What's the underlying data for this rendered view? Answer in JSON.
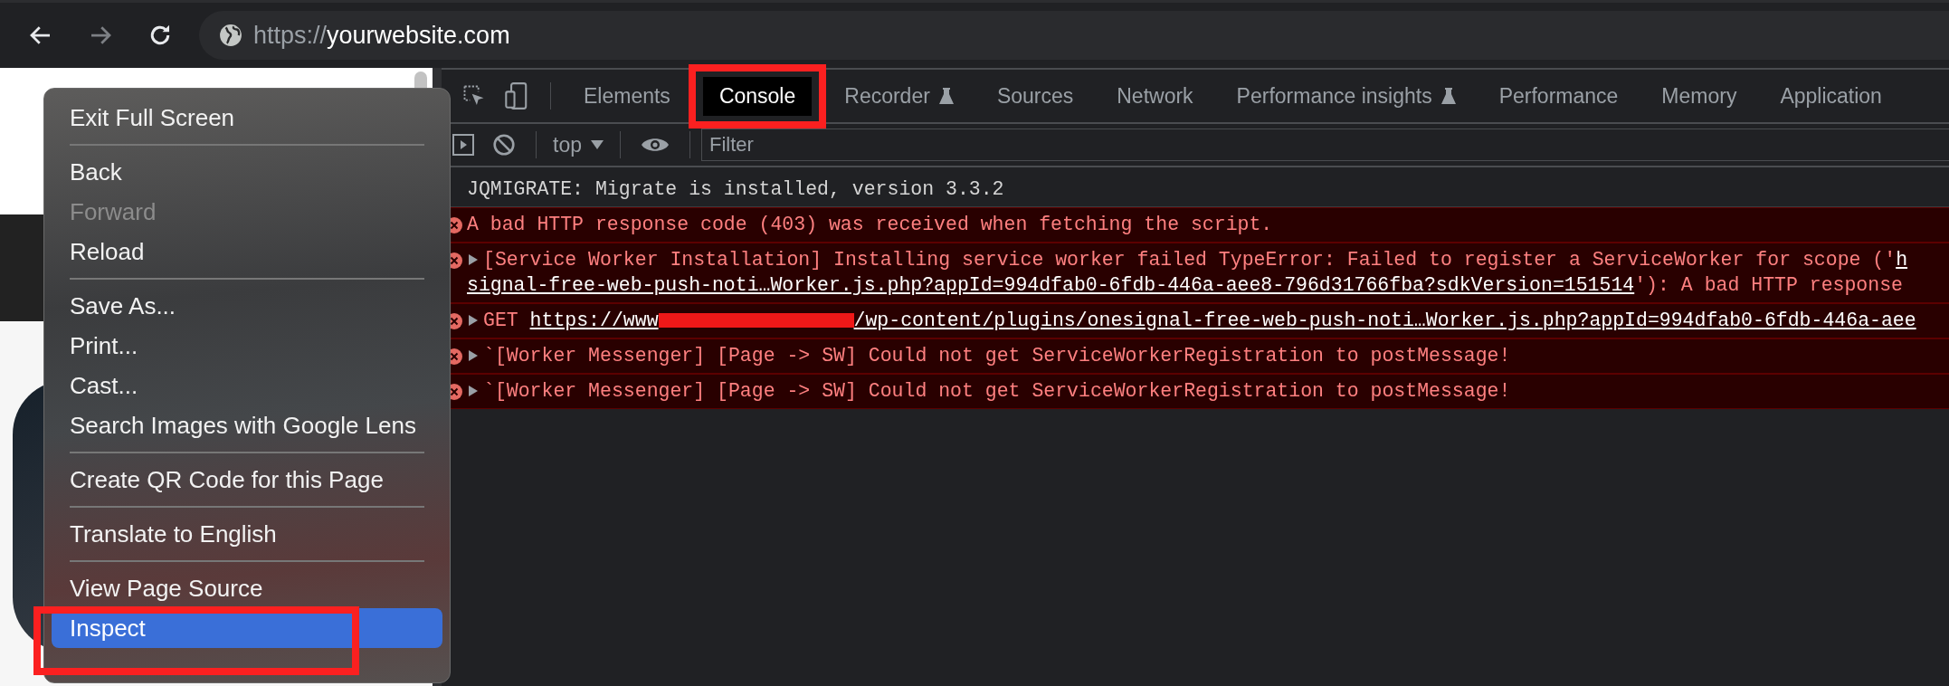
{
  "toolbar": {
    "nav": [
      {
        "kind": "back",
        "disabled": false
      },
      {
        "kind": "forward",
        "disabled": true
      },
      {
        "kind": "reload",
        "disabled": false
      }
    ],
    "address": {
      "scheme": "https://",
      "host": "yourwebsite.com"
    }
  },
  "devtools": {
    "tabs": [
      {
        "label": "Elements",
        "selected": false,
        "experimental": false,
        "annotated": false
      },
      {
        "label": "Console",
        "selected": true,
        "experimental": false,
        "annotated": true
      },
      {
        "label": "Recorder",
        "selected": false,
        "experimental": true,
        "annotated": false
      },
      {
        "label": "Sources",
        "selected": false,
        "experimental": false,
        "annotated": false
      },
      {
        "label": "Network",
        "selected": false,
        "experimental": false,
        "annotated": false
      },
      {
        "label": "Performance insights",
        "selected": false,
        "experimental": true,
        "annotated": false
      },
      {
        "label": "Performance",
        "selected": false,
        "experimental": false,
        "annotated": false
      },
      {
        "label": "Memory",
        "selected": false,
        "experimental": false,
        "annotated": false
      },
      {
        "label": "Application",
        "selected": false,
        "experimental": false,
        "annotated": false
      }
    ],
    "console_toolbar": {
      "context": "top",
      "filter": {
        "placeholder": "Filter"
      }
    },
    "messages": [
      {
        "kind": "info",
        "expandable": false,
        "lines": [
          [
            {
              "kind": "text",
              "text": "JQMIGRATE: Migrate is installed, version 3.3.2"
            }
          ]
        ]
      },
      {
        "kind": "error",
        "expandable": false,
        "lines": [
          [
            {
              "kind": "text",
              "text": "A bad HTTP response code (403) was received when fetching the script."
            }
          ]
        ]
      },
      {
        "kind": "error",
        "expandable": true,
        "lines": [
          [
            {
              "kind": "text",
              "text": "[Service Worker Installation] Installing service worker failed TypeError: Failed to register a ServiceWorker for scope ('"
            },
            {
              "kind": "link",
              "text": "h"
            }
          ],
          [
            {
              "kind": "link",
              "text": "signal-free-web-push-noti…Worker.js.php?appId=994dfab0-6fdb-446a-aee8-796d31766fba?sdkVersion=151514"
            },
            {
              "kind": "text",
              "text": "'): A bad HTTP response"
            }
          ]
        ]
      },
      {
        "kind": "error",
        "expandable": true,
        "lines": [
          [
            {
              "kind": "text",
              "text": "GET "
            },
            {
              "kind": "link",
              "text": "https://www"
            },
            {
              "kind": "redacted"
            },
            {
              "kind": "link",
              "text": "/wp-content/plugins/onesignal-free-web-push-noti…Worker.js.php?appId=994dfab0-6fdb-446a-aee"
            }
          ]
        ]
      },
      {
        "kind": "error",
        "expandable": true,
        "lines": [
          [
            {
              "kind": "text",
              "text": "`[Worker Messenger] [Page -> SW] Could not get ServiceWorkerRegistration to postMessage!"
            }
          ]
        ]
      },
      {
        "kind": "error",
        "expandable": true,
        "lines": [
          [
            {
              "kind": "text",
              "text": "`[Worker Messenger] [Page -> SW] Could not get ServiceWorkerRegistration to postMessage!"
            }
          ]
        ]
      }
    ]
  },
  "context_menu": {
    "groups": [
      [
        {
          "label": "Exit Full Screen",
          "disabled": false,
          "selected": false,
          "annotated": false
        }
      ],
      [
        {
          "label": "Back",
          "disabled": false,
          "selected": false,
          "annotated": false
        },
        {
          "label": "Forward",
          "disabled": true,
          "selected": false,
          "annotated": false
        },
        {
          "label": "Reload",
          "disabled": false,
          "selected": false,
          "annotated": false
        }
      ],
      [
        {
          "label": "Save As...",
          "disabled": false,
          "selected": false,
          "annotated": false
        },
        {
          "label": "Print...",
          "disabled": false,
          "selected": false,
          "annotated": false
        },
        {
          "label": "Cast...",
          "disabled": false,
          "selected": false,
          "annotated": false
        },
        {
          "label": "Search Images with Google Lens",
          "disabled": false,
          "selected": false,
          "annotated": false
        }
      ],
      [
        {
          "label": "Create QR Code for this Page",
          "disabled": false,
          "selected": false,
          "annotated": false
        }
      ],
      [
        {
          "label": "Translate to English",
          "disabled": false,
          "selected": false,
          "annotated": false
        }
      ],
      [
        {
          "label": "View Page Source",
          "disabled": false,
          "selected": false,
          "annotated": false
        },
        {
          "label": "Inspect",
          "disabled": false,
          "selected": true,
          "annotated": true
        }
      ]
    ]
  }
}
